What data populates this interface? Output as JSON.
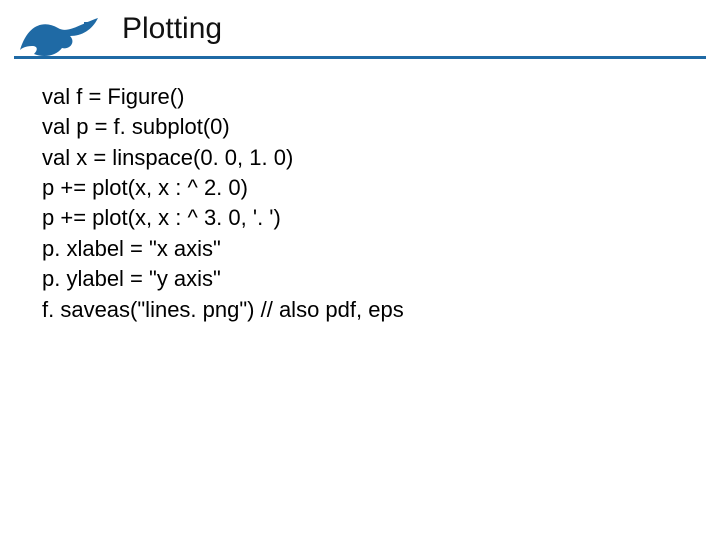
{
  "title": "Plotting",
  "code": {
    "l1": "val f = Figure()",
    "l2": "val p = f. subplot(0)",
    "l3": "val x = linspace(0. 0, 1. 0)",
    "l4": "p += plot(x, x : ^ 2. 0)",
    "l5": "p += plot(x, x : ^ 3. 0, '. ')",
    "l6": "p. xlabel = \"x axis\"",
    "l7": "p. ylabel = \"y axis\"",
    "l8": "f. saveas(\"lines. png\") // also pdf, eps"
  },
  "logo": {
    "accent": "#1f6aa5"
  }
}
